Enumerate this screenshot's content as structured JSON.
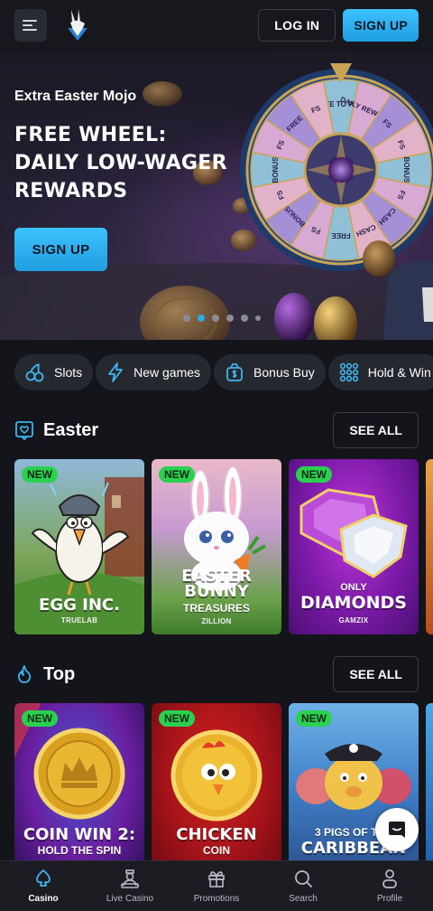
{
  "header": {
    "login_label": "LOG IN",
    "signup_label": "SIGN UP",
    "colors": {
      "accent": "#2ea9ec",
      "background": "#17181d"
    }
  },
  "hero": {
    "subtitle": "Extra Easter Mojo",
    "title_line1": "FREE WHEEL:",
    "title_line2": "DAILY LOW-WAGER",
    "title_line3": "REWARDS",
    "cta_label": "SIGN UP",
    "wheel_segments": [
      "FREE TO PLAY",
      "DAILY REWARD",
      "FS",
      "FS",
      "BONUS",
      "FS",
      "CASH",
      "CASH",
      "FREE",
      "FS",
      "BONUS",
      "FS",
      "BONUS",
      "FS",
      "FREE",
      "FS"
    ],
    "slides_count": 6,
    "active_slide": 2
  },
  "categories": [
    {
      "label": "Slots",
      "icon": "cherries-icon"
    },
    {
      "label": "New games",
      "icon": "lightning-icon"
    },
    {
      "label": "Bonus Buy",
      "icon": "dollar-bag-icon"
    },
    {
      "label": "Hold & Win",
      "icon": "grid-dots-icon"
    }
  ],
  "sections": {
    "easter": {
      "title": "Easter",
      "see_all": "SEE ALL",
      "games": [
        {
          "badge": "NEW",
          "title": "EGG INC.",
          "provider": "TRUELAB"
        },
        {
          "badge": "NEW",
          "title_1": "EASTER",
          "title_2": "BUNNY",
          "subtitle": "TREASURES",
          "provider": "ZILLION"
        },
        {
          "badge": "NEW",
          "pre": "ONLY",
          "title": "DIAMONDS",
          "provider": "GAMZIX"
        }
      ]
    },
    "top": {
      "title": "Top",
      "see_all": "SEE ALL",
      "games": [
        {
          "badge": "NEW",
          "title": "COIN WIN 2:",
          "subtitle": "HOLD THE SPIN"
        },
        {
          "badge": "NEW",
          "title": "CHICKEN",
          "subtitle": "COIN"
        },
        {
          "badge": "NEW",
          "pre": "3 PIGS OF THE",
          "title": "CARIBBEAN"
        }
      ]
    }
  },
  "bottom_nav": [
    {
      "label": "Casino",
      "icon": "spade-icon",
      "active": true
    },
    {
      "label": "Live Casino",
      "icon": "dealer-icon",
      "active": false
    },
    {
      "label": "Promotions",
      "icon": "gift-icon",
      "active": false
    },
    {
      "label": "Search",
      "icon": "search-icon",
      "active": false
    },
    {
      "label": "Profile",
      "icon": "user-icon",
      "active": false
    }
  ]
}
